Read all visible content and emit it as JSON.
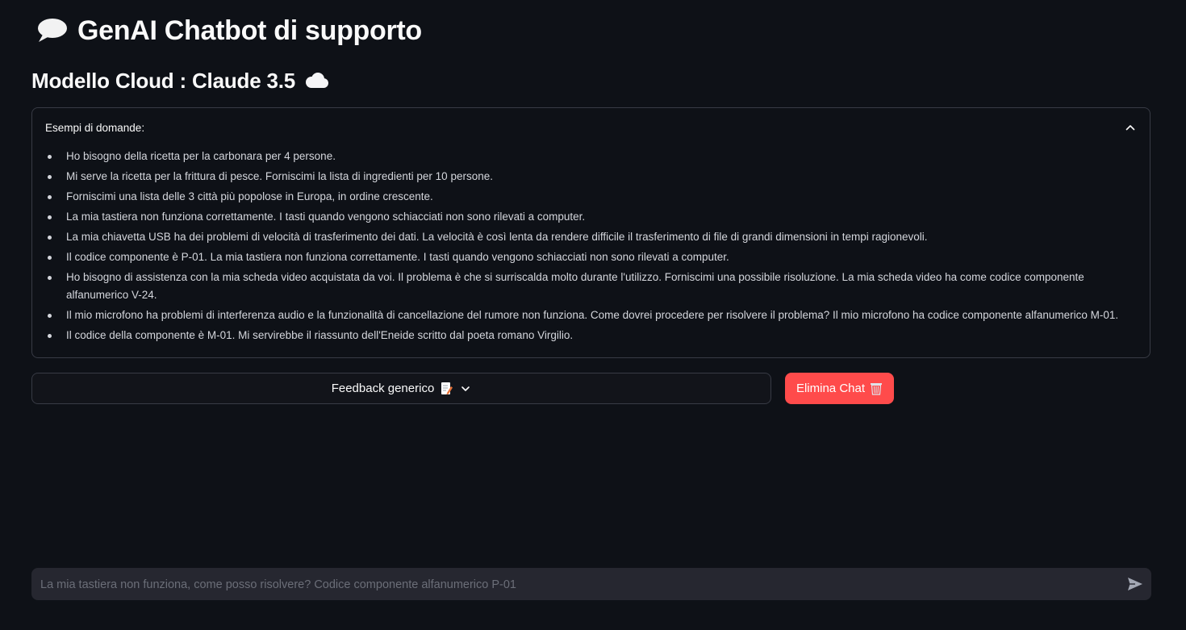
{
  "header": {
    "title": "GenAI Chatbot di supporto",
    "title_icon": "speech-balloon-icon",
    "subtitle": "Modello Cloud : Claude 3.5",
    "subtitle_icon": "cloud-icon"
  },
  "expander": {
    "label": "Esempi di domande:",
    "expanded": true,
    "items": [
      "Ho bisogno della ricetta per la carbonara per 4 persone.",
      "Mi serve la ricetta per la frittura di pesce. Forniscimi la lista di ingredienti per 10 persone.",
      "Forniscimi una lista delle 3 città più popolose in Europa, in ordine crescente.",
      "La mia tastiera non funziona correttamente. I tasti quando vengono schiacciati non sono rilevati a computer.",
      "La mia chiavetta USB ha dei problemi di velocità di trasferimento dei dati. La velocità è così lenta da rendere difficile il trasferimento di file di grandi dimensioni in tempi ragionevoli.",
      "Il codice componente è P-01. La mia tastiera non funziona correttamente. I tasti quando vengono schiacciati non sono rilevati a computer.",
      "Ho bisogno di assistenza con la mia scheda video acquistata da voi. Il problema è che si surriscalda molto durante l'utilizzo. Forniscimi una possibile risoluzione. La mia scheda video ha come codice componente alfanumerico V-24.",
      "Il mio microfono ha problemi di interferenza audio e la funzionalità di cancellazione del rumore non funziona. Come dovrei procedere per risolvere il problema? Il mio microfono ha codice componente alfanumerico M-01.",
      "Il codice della componente è M-01. Mi servirebbe il riassunto dell'Eneide scritto dal poeta romano Virgilio."
    ]
  },
  "buttons": {
    "feedback_label": "Feedback generico",
    "feedback_icon": "memo-icon",
    "delete_label": "Elimina Chat",
    "delete_icon": "wastebasket-icon"
  },
  "chat_input": {
    "placeholder": "La mia tastiera non funziona, come posso risolvere? Codice componente alfanumerico P-01",
    "value": ""
  },
  "colors": {
    "background": "#0e1117",
    "text": "#fafafa",
    "border": "#383b45",
    "primary": "#ff4b4b",
    "input_bg": "#262730"
  }
}
